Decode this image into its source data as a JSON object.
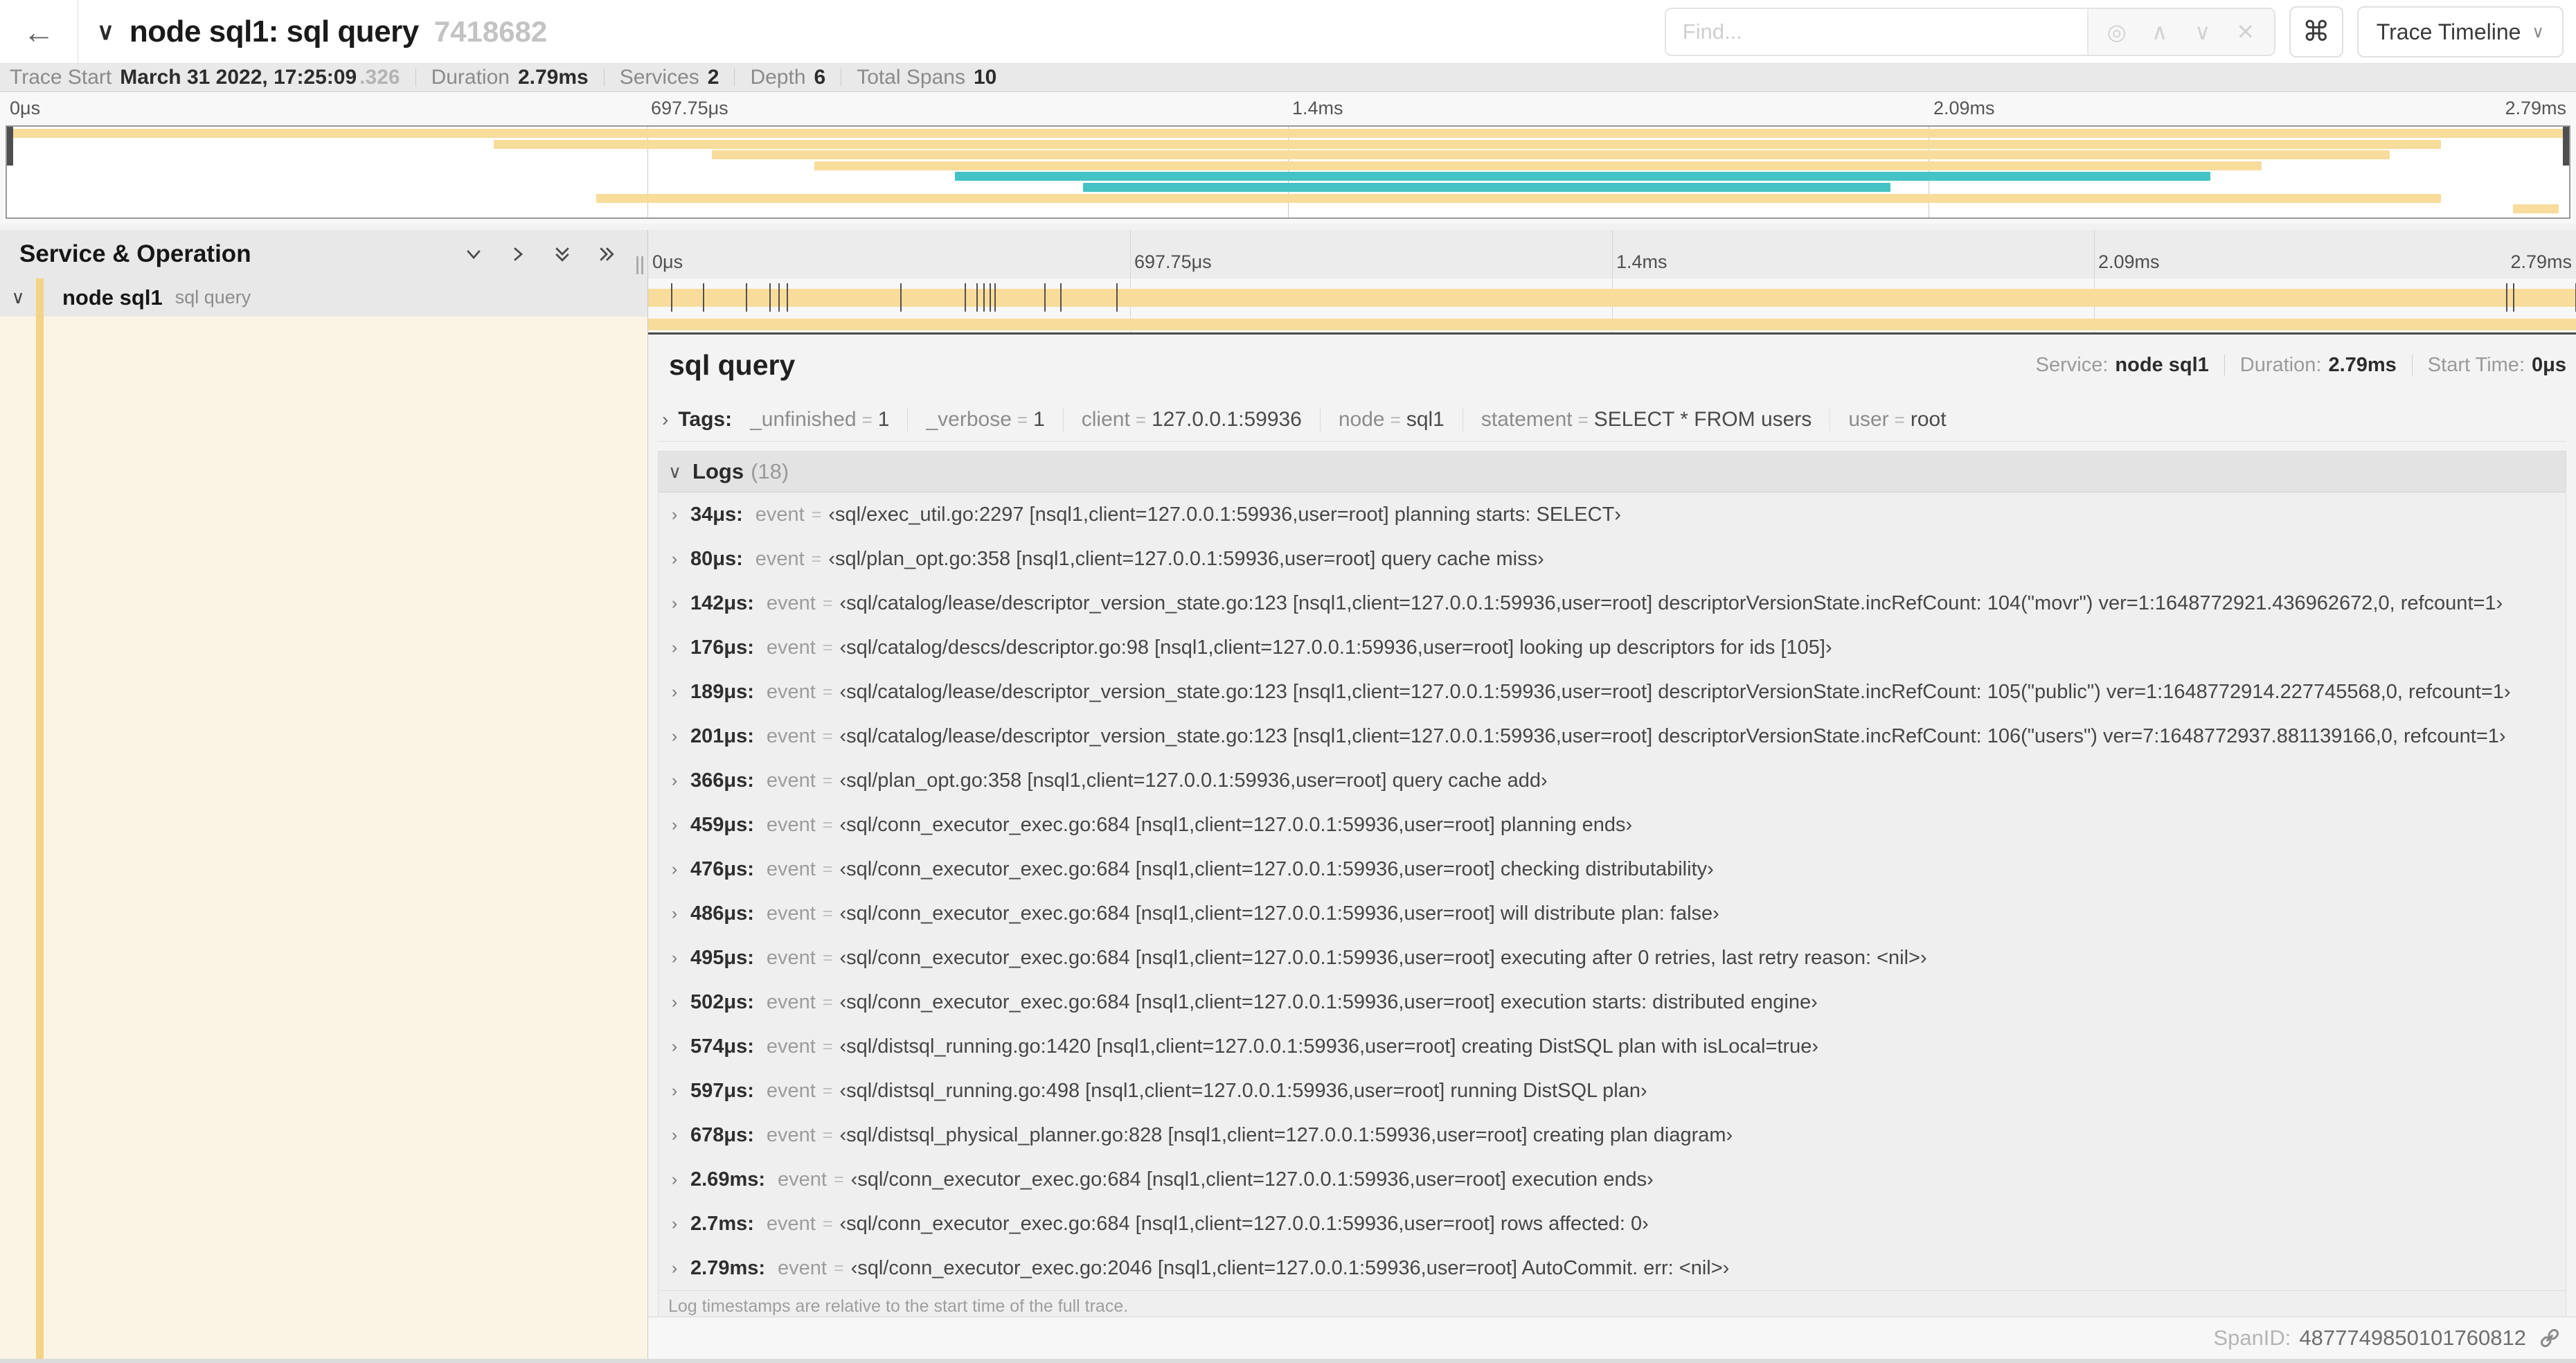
{
  "header": {
    "back_glyph": "←",
    "collapser_glyph": "∨",
    "title": "node sql1: sql query",
    "trace_id": "7418682",
    "find_placeholder": "Find...",
    "locate_glyph": "◎",
    "prev_glyph": "∧",
    "next_glyph": "∨",
    "clear_glyph": "✕",
    "shortcut_glyph": "⌘",
    "view_button": "Trace Timeline",
    "view_dd_glyph": "∨"
  },
  "trace_info": {
    "items": [
      {
        "label": "Trace Start",
        "value": "March 31 2022, 17:25:09",
        "extra": ".326"
      },
      {
        "label": "Duration",
        "value": "2.79ms",
        "extra": ""
      },
      {
        "label": "Services",
        "value": "2",
        "extra": ""
      },
      {
        "label": "Depth",
        "value": "6",
        "extra": ""
      },
      {
        "label": "Total Spans",
        "value": "10",
        "extra": ""
      }
    ]
  },
  "timeline": {
    "ticks": [
      "0μs",
      "697.75μs",
      "1.4ms",
      "2.09ms",
      "2.79ms"
    ],
    "duration_us": 2790
  },
  "minimap": {
    "colors": {
      "tan": "#f7dc9c",
      "teal": "#43c3c3"
    },
    "rows": [
      {
        "color": "tan",
        "start": 0,
        "end": 100
      },
      {
        "color": "tan",
        "start": 19,
        "end": 95
      },
      {
        "color": "tan",
        "start": 27.5,
        "end": 93
      },
      {
        "color": "tan",
        "start": 31.5,
        "end": 88
      },
      {
        "color": "teal",
        "start": 37,
        "end": 86
      },
      {
        "color": "teal",
        "start": 42,
        "end": 73.5
      },
      {
        "color": "tan",
        "start": 23,
        "end": 95
      },
      {
        "color": "tan",
        "start": 97.8,
        "end": 99.6
      }
    ]
  },
  "sidebar": {
    "header": "Service & Operation",
    "row": {
      "caret_glyph": "∨",
      "service": "node sql1",
      "operation": "sql query"
    }
  },
  "detail": {
    "title": "sql query",
    "meta": [
      {
        "label": "Service:",
        "value": "node sql1"
      },
      {
        "label": "Duration:",
        "value": "2.79ms"
      },
      {
        "label": "Start Time:",
        "value": "0μs"
      }
    ],
    "tags": {
      "caret_glyph": "›",
      "label": "Tags:",
      "eq_glyph": "=",
      "items": [
        {
          "key": "_unfinished",
          "value": "1"
        },
        {
          "key": "_verbose",
          "value": "1"
        },
        {
          "key": "client",
          "value": "127.0.0.1:59936"
        },
        {
          "key": "node",
          "value": "sql1"
        },
        {
          "key": "statement",
          "value": "SELECT * FROM users"
        },
        {
          "key": "user",
          "value": "root"
        }
      ]
    },
    "logs": {
      "caret_glyph": "∨",
      "row_caret_glyph": "›",
      "label": "Logs",
      "count": "(18)",
      "field_label": "event",
      "eq_glyph": "=",
      "entries": [
        {
          "time": "34μs:",
          "us": 34,
          "value": "‹sql/exec_util.go:2297 [nsql1,client=127.0.0.1:59936,user=root] planning starts: SELECT›"
        },
        {
          "time": "80μs:",
          "us": 80,
          "value": "‹sql/plan_opt.go:358 [nsql1,client=127.0.0.1:59936,user=root] query cache miss›"
        },
        {
          "time": "142μs:",
          "us": 142,
          "value": "‹sql/catalog/lease/descriptor_version_state.go:123 [nsql1,client=127.0.0.1:59936,user=root] descriptorVersionState.incRefCount: 104(\"movr\") ver=1:1648772921.436962672,0, refcount=1›"
        },
        {
          "time": "176μs:",
          "us": 176,
          "value": "‹sql/catalog/descs/descriptor.go:98 [nsql1,client=127.0.0.1:59936,user=root] looking up descriptors for ids [105]›"
        },
        {
          "time": "189μs:",
          "us": 189,
          "value": "‹sql/catalog/lease/descriptor_version_state.go:123 [nsql1,client=127.0.0.1:59936,user=root] descriptorVersionState.incRefCount: 105(\"public\") ver=1:1648772914.227745568,0, refcount=1›"
        },
        {
          "time": "201μs:",
          "us": 201,
          "value": "‹sql/catalog/lease/descriptor_version_state.go:123 [nsql1,client=127.0.0.1:59936,user=root] descriptorVersionState.incRefCount: 106(\"users\") ver=7:1648772937.881139166,0, refcount=1›"
        },
        {
          "time": "366μs:",
          "us": 366,
          "value": "‹sql/plan_opt.go:358 [nsql1,client=127.0.0.1:59936,user=root] query cache add›"
        },
        {
          "time": "459μs:",
          "us": 459,
          "value": "‹sql/conn_executor_exec.go:684 [nsql1,client=127.0.0.1:59936,user=root] planning ends›"
        },
        {
          "time": "476μs:",
          "us": 476,
          "value": "‹sql/conn_executor_exec.go:684 [nsql1,client=127.0.0.1:59936,user=root] checking distributability›"
        },
        {
          "time": "486μs:",
          "us": 486,
          "value": "‹sql/conn_executor_exec.go:684 [nsql1,client=127.0.0.1:59936,user=root] will distribute plan: false›"
        },
        {
          "time": "495μs:",
          "us": 495,
          "value": "‹sql/conn_executor_exec.go:684 [nsql1,client=127.0.0.1:59936,user=root] executing after 0 retries, last retry reason: <nil>›"
        },
        {
          "time": "502μs:",
          "us": 502,
          "value": "‹sql/conn_executor_exec.go:684 [nsql1,client=127.0.0.1:59936,user=root] execution starts: distributed engine›"
        },
        {
          "time": "574μs:",
          "us": 574,
          "value": "‹sql/distsql_running.go:1420 [nsql1,client=127.0.0.1:59936,user=root] creating DistSQL plan with isLocal=true›"
        },
        {
          "time": "597μs:",
          "us": 597,
          "value": "‹sql/distsql_running.go:498 [nsql1,client=127.0.0.1:59936,user=root] running DistSQL plan›"
        },
        {
          "time": "678μs:",
          "us": 678,
          "value": "‹sql/distsql_physical_planner.go:828 [nsql1,client=127.0.0.1:59936,user=root] creating plan diagram›"
        },
        {
          "time": "2.69ms:",
          "us": 2690,
          "value": "‹sql/conn_executor_exec.go:684 [nsql1,client=127.0.0.1:59936,user=root] execution ends›"
        },
        {
          "time": "2.7ms:",
          "us": 2700,
          "value": "‹sql/conn_executor_exec.go:684 [nsql1,client=127.0.0.1:59936,user=root] rows affected: 0›"
        },
        {
          "time": "2.79ms:",
          "us": 2790,
          "value": "‹sql/conn_executor_exec.go:2046 [nsql1,client=127.0.0.1:59936,user=root] AutoCommit. err: <nil>›"
        }
      ],
      "footnote": "Log timestamps are relative to the start time of the full trace."
    },
    "footer": {
      "span_id_label": "SpanID:",
      "span_id": "4877749850101760812"
    }
  }
}
